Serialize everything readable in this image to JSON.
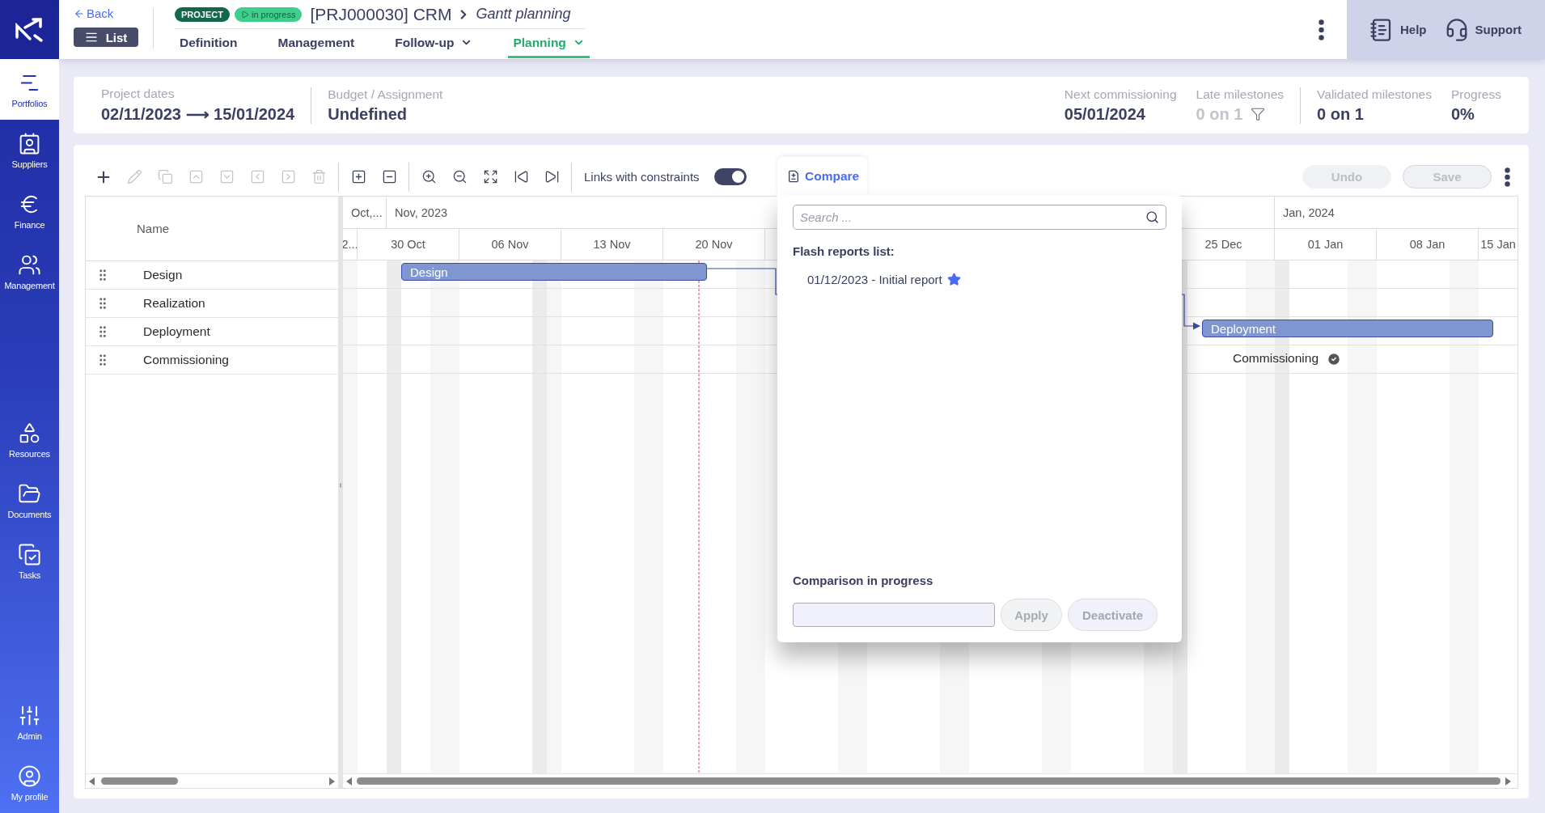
{
  "sidebar": {
    "groups": [
      {
        "items": [
          {
            "label": "Portfolios",
            "selected": true
          },
          {
            "label": "Suppliers",
            "selected": false
          },
          {
            "label": "Finance",
            "selected": false
          },
          {
            "label": "Management",
            "selected": false
          }
        ]
      },
      {
        "items": [
          {
            "label": "Resources",
            "selected": false
          },
          {
            "label": "Documents",
            "selected": false
          },
          {
            "label": "Tasks",
            "selected": false
          }
        ]
      },
      {
        "items": [
          {
            "label": "Admin",
            "selected": false
          },
          {
            "label": "My profile",
            "selected": false
          }
        ]
      }
    ]
  },
  "header": {
    "back": "Back",
    "list_button": "List",
    "badges": [
      {
        "label": "PROJECT",
        "kind": "type"
      },
      {
        "label": "in progress",
        "kind": "status"
      }
    ],
    "title": "[PRJ000030] CRM",
    "subtitle": "Gantt planning",
    "tabs": [
      {
        "label": "Definition",
        "selected": false,
        "dropdown": false
      },
      {
        "label": "Management",
        "selected": false,
        "dropdown": false
      },
      {
        "label": "Follow-up",
        "selected": false,
        "dropdown": true
      },
      {
        "label": "Planning",
        "selected": true,
        "dropdown": true
      }
    ],
    "help": "Help",
    "support": "Support"
  },
  "summary": {
    "groups": [
      {
        "items": [
          {
            "label": "Project dates",
            "value": "02/11/2023 ⟶ 15/01/2024",
            "muted": false,
            "filter": false
          }
        ]
      },
      {
        "items": [
          {
            "label": "Budget / Assignment",
            "value": "Undefined",
            "muted": false,
            "filter": false
          }
        ]
      },
      {
        "items": [
          {
            "label": "Next commissioning",
            "value": "05/01/2024",
            "muted": false,
            "filter": false
          },
          {
            "label": "Late milestones",
            "value": "0 on 1",
            "muted": true,
            "filter": true
          }
        ]
      },
      {
        "items": [
          {
            "label": "Validated milestones",
            "value": "0 on 1",
            "muted": false,
            "filter": false
          },
          {
            "label": "Progress",
            "value": "0%",
            "muted": false,
            "filter": false
          }
        ]
      }
    ]
  },
  "toolbar": {
    "actions": [
      {
        "disabled": false
      },
      {
        "disabled": true
      },
      {
        "disabled": true
      },
      {
        "disabled": true
      },
      {
        "disabled": true
      },
      {
        "disabled": true
      },
      {
        "disabled": true
      },
      {
        "disabled": true
      },
      {
        "disabled": false
      },
      {
        "disabled": false
      },
      {
        "disabled": false
      },
      {
        "disabled": false
      },
      {
        "disabled": false
      },
      {
        "disabled": false
      },
      {
        "disabled": false
      }
    ],
    "links_toggle": {
      "label": "Links with constraints",
      "on": true
    },
    "undo": {
      "label": "Undo",
      "disabled": true
    },
    "save": {
      "label": "Save",
      "disabled": true
    }
  },
  "gantt": {
    "name_header": "Name",
    "months": [
      "Oct,...",
      "Nov, 2023",
      "Jan, 2024"
    ],
    "weeks": [
      "2...",
      "30 Oct",
      "06 Nov",
      "13 Nov",
      "20 Nov",
      "25 Dec",
      "01 Jan",
      "08 Jan",
      "15 Jan"
    ],
    "tasks": [
      {
        "name": "Design",
        "kind": "bar",
        "bar_label": "Design"
      },
      {
        "name": "Realization",
        "kind": "none"
      },
      {
        "name": "Deployment",
        "kind": "bar",
        "bar_label": "Deployment"
      },
      {
        "name": "Commissioning",
        "kind": "milestone",
        "milestone_label": "Commissioning",
        "validated": true
      }
    ]
  },
  "compare": {
    "tab": "Compare",
    "search_placeholder": "Search ...",
    "list_title": "Flash reports list:",
    "reports": [
      {
        "label": "01/12/2023 - Initial report",
        "favorite": true
      }
    ],
    "progress_title": "Comparison in progress",
    "apply": "Apply",
    "deactivate": "Deactivate"
  }
}
